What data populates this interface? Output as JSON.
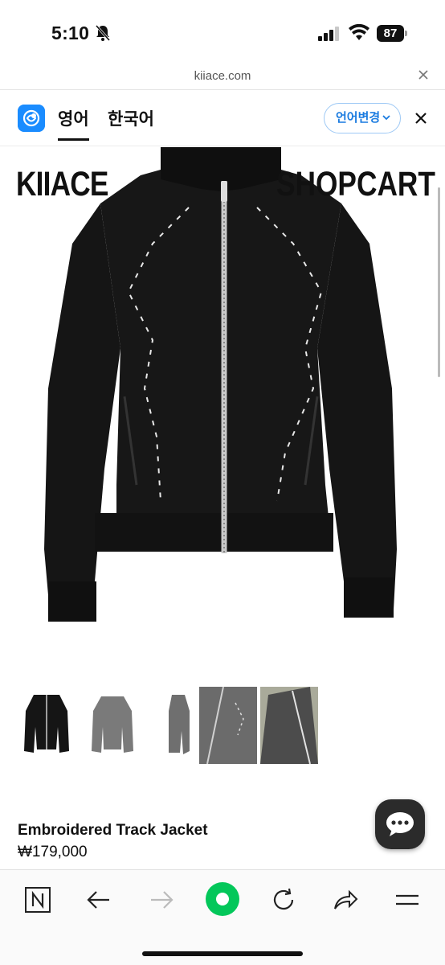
{
  "status_bar": {
    "time": "5:10",
    "battery": "87"
  },
  "browser": {
    "url": "kiiace.com"
  },
  "translate_bar": {
    "tab_english": "영어",
    "tab_korean": "한국어",
    "change_language": "언어변경"
  },
  "site": {
    "brand": "KIIACE",
    "nav": {
      "shop": "SHOP",
      "cart": "CART"
    }
  },
  "product": {
    "title": "Embroidered Track Jacket",
    "price": "₩179,000"
  },
  "icons": {
    "bell": "bell-slash-icon",
    "signal": "signal-icon",
    "wifi": "wifi-icon",
    "close": "close-icon",
    "translate": "translate-logo-icon",
    "chevron": "chevron-down-icon",
    "chat": "chat-icon",
    "naver": "naver-n-icon",
    "back": "arrow-left-icon",
    "forward": "arrow-right-icon",
    "home": "green-circle-icon",
    "reload": "reload-icon",
    "share": "share-icon",
    "menu": "menu-icon"
  },
  "colors": {
    "accent_blue": "#1a8cff",
    "record_green": "#03c75a",
    "jacket": "#161616"
  }
}
